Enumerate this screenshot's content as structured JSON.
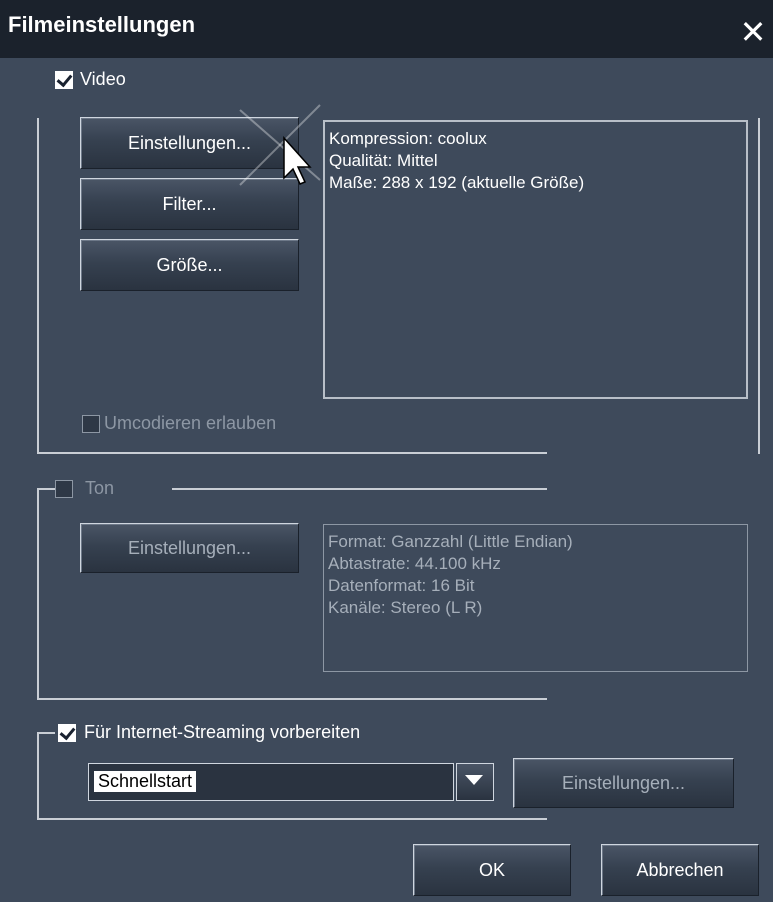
{
  "window": {
    "title": "Filmeinstellungen",
    "close_label": "✕"
  },
  "video": {
    "checkbox_label": "Video",
    "checked": true,
    "buttons": {
      "settings": "Einstellungen...",
      "filter": "Filter...",
      "size": "Größe..."
    },
    "info_lines": [
      "Kompression: coolux",
      "Qualität: Mittel",
      "Maße: 288 x 192 (aktuelle Größe)"
    ],
    "transcode_label": "Umcodieren erlauben"
  },
  "audio": {
    "checkbox_label": "Ton",
    "checked": false,
    "settings_button": "Einstellungen...",
    "info_lines": [
      "Format: Ganzzahl (Little Endian)",
      "Abtastrate: 44.100 kHz",
      "Datenformat: 16 Bit",
      "Kanäle: Stereo (L R)"
    ]
  },
  "streaming": {
    "checkbox_label": "Für Internet-Streaming vorbereiten",
    "checked": true,
    "selected_option": "Schnellstart",
    "settings_button": "Einstellungen..."
  },
  "footer": {
    "ok": "OK",
    "cancel": "Abbrechen"
  }
}
